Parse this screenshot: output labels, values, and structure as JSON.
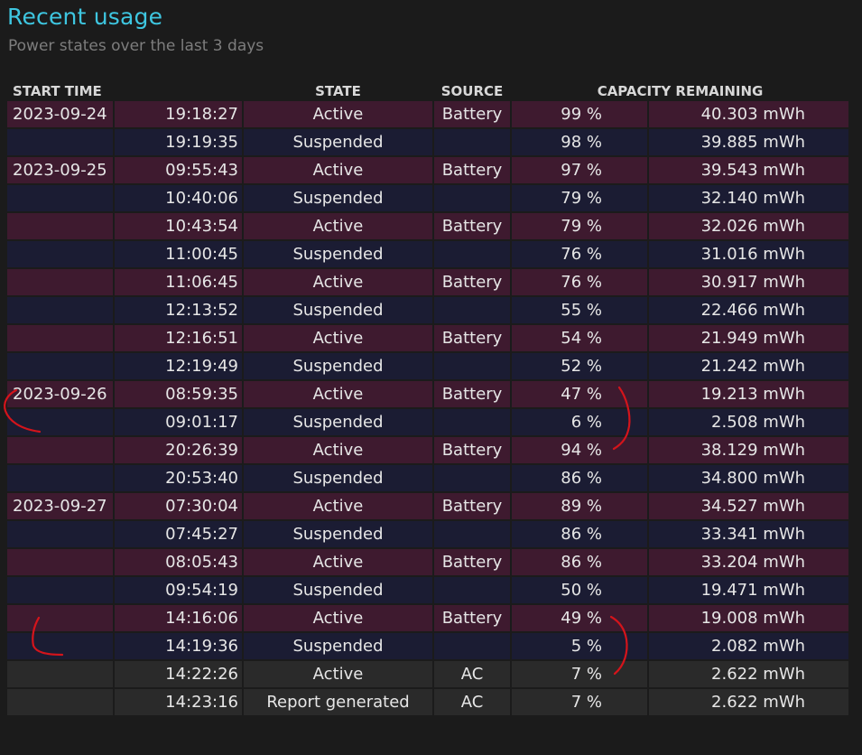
{
  "header": {
    "title": "Recent usage",
    "subtitle": "Power states over the last 3 days"
  },
  "table": {
    "columns": {
      "start_time": "START TIME",
      "state": "STATE",
      "source": "SOURCE",
      "capacity": "CAPACITY REMAINING"
    },
    "rows": [
      {
        "date": "2023-09-24",
        "time": "19:18:27",
        "state": "Active",
        "source": "Battery",
        "percent": "99 %",
        "mwh": "40.303 mWh",
        "kind": "active"
      },
      {
        "date": "",
        "time": "19:19:35",
        "state": "Suspended",
        "source": "",
        "percent": "98 %",
        "mwh": "39.885 mWh",
        "kind": "susp"
      },
      {
        "date": "2023-09-25",
        "time": "09:55:43",
        "state": "Active",
        "source": "Battery",
        "percent": "97 %",
        "mwh": "39.543 mWh",
        "kind": "active"
      },
      {
        "date": "",
        "time": "10:40:06",
        "state": "Suspended",
        "source": "",
        "percent": "79 %",
        "mwh": "32.140 mWh",
        "kind": "susp"
      },
      {
        "date": "",
        "time": "10:43:54",
        "state": "Active",
        "source": "Battery",
        "percent": "79 %",
        "mwh": "32.026 mWh",
        "kind": "active"
      },
      {
        "date": "",
        "time": "11:00:45",
        "state": "Suspended",
        "source": "",
        "percent": "76 %",
        "mwh": "31.016 mWh",
        "kind": "susp"
      },
      {
        "date": "",
        "time": "11:06:45",
        "state": "Active",
        "source": "Battery",
        "percent": "76 %",
        "mwh": "30.917 mWh",
        "kind": "active"
      },
      {
        "date": "",
        "time": "12:13:52",
        "state": "Suspended",
        "source": "",
        "percent": "55 %",
        "mwh": "22.466 mWh",
        "kind": "susp"
      },
      {
        "date": "",
        "time": "12:16:51",
        "state": "Active",
        "source": "Battery",
        "percent": "54 %",
        "mwh": "21.949 mWh",
        "kind": "active"
      },
      {
        "date": "",
        "time": "12:19:49",
        "state": "Suspended",
        "source": "",
        "percent": "52 %",
        "mwh": "21.242 mWh",
        "kind": "susp"
      },
      {
        "date": "2023-09-26",
        "time": "08:59:35",
        "state": "Active",
        "source": "Battery",
        "percent": "47 %",
        "mwh": "19.213 mWh",
        "kind": "active"
      },
      {
        "date": "",
        "time": "09:01:17",
        "state": "Suspended",
        "source": "",
        "percent": "6 %",
        "mwh": "2.508 mWh",
        "kind": "susp"
      },
      {
        "date": "",
        "time": "20:26:39",
        "state": "Active",
        "source": "Battery",
        "percent": "94 %",
        "mwh": "38.129 mWh",
        "kind": "active"
      },
      {
        "date": "",
        "time": "20:53:40",
        "state": "Suspended",
        "source": "",
        "percent": "86 %",
        "mwh": "34.800 mWh",
        "kind": "susp"
      },
      {
        "date": "2023-09-27",
        "time": "07:30:04",
        "state": "Active",
        "source": "Battery",
        "percent": "89 %",
        "mwh": "34.527 mWh",
        "kind": "active"
      },
      {
        "date": "",
        "time": "07:45:27",
        "state": "Suspended",
        "source": "",
        "percent": "86 %",
        "mwh": "33.341 mWh",
        "kind": "susp"
      },
      {
        "date": "",
        "time": "08:05:43",
        "state": "Active",
        "source": "Battery",
        "percent": "86 %",
        "mwh": "33.204 mWh",
        "kind": "active"
      },
      {
        "date": "",
        "time": "09:54:19",
        "state": "Suspended",
        "source": "",
        "percent": "50 %",
        "mwh": "19.471 mWh",
        "kind": "susp"
      },
      {
        "date": "",
        "time": "14:16:06",
        "state": "Active",
        "source": "Battery",
        "percent": "49 %",
        "mwh": "19.008 mWh",
        "kind": "active"
      },
      {
        "date": "",
        "time": "14:19:36",
        "state": "Suspended",
        "source": "",
        "percent": "5 %",
        "mwh": "2.082 mWh",
        "kind": "susp"
      },
      {
        "date": "",
        "time": "14:22:26",
        "state": "Active",
        "source": "AC",
        "percent": "7 %",
        "mwh": "2.622 mWh",
        "kind": "ac"
      },
      {
        "date": "",
        "time": "14:23:16",
        "state": "Report generated",
        "source": "AC",
        "percent": "7 %",
        "mwh": "2.622 mWh",
        "kind": "ac"
      }
    ]
  },
  "colors": {
    "title": "#3ec6e0",
    "active_row": "#3e1a2f",
    "suspended_row": "#1b1c33",
    "ac_row": "#2a2a2a",
    "annotation_marks": "#d4141b"
  }
}
